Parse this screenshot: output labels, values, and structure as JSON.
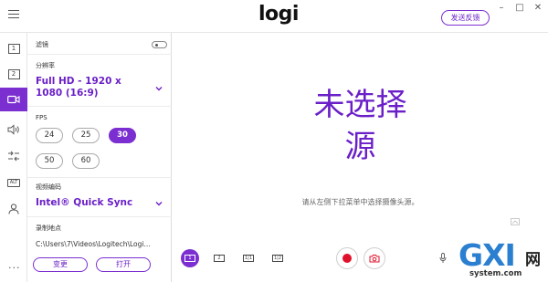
{
  "app": {
    "logo": "logi",
    "feedback_label": "发送反馈"
  },
  "window_controls": [
    "–",
    "□",
    "✕"
  ],
  "rail": {
    "items": [
      {
        "name": "layout-1",
        "label": "1"
      },
      {
        "name": "layout-2",
        "label": "2"
      },
      {
        "name": "camera",
        "label": ""
      },
      {
        "name": "audio",
        "label": ""
      },
      {
        "name": "transitions",
        "label": ""
      },
      {
        "name": "alt",
        "label": "ALT"
      },
      {
        "name": "account",
        "label": ""
      }
    ]
  },
  "panel": {
    "filter_label": "滤镜",
    "resolution_label": "分辨率",
    "resolution_value": "Full HD - 1920 x 1080 (16:9)",
    "fps_label": "FPS",
    "fps_options": [
      "24",
      "25",
      "30",
      "50",
      "60"
    ],
    "fps_selected": "30",
    "encoder_label": "视频编码",
    "encoder_value": "Intel® Quick Sync",
    "save_location_label": "录制地点",
    "save_path": "C:\\Users\\7\\Videos\\Logitech\\Logi...",
    "change_button": "变更",
    "open_button": "打开",
    "more": "···"
  },
  "preview": {
    "no_camera_line1": "未选择",
    "no_camera_line2": "源",
    "hint": "请从左侧下拉菜单中选择摄像头源。"
  },
  "toolbar": {
    "layout_labels": [
      "1",
      "2",
      "1|1",
      "1|2"
    ]
  },
  "watermark": {
    "brand": "GXI",
    "net": "网",
    "site": "system.com"
  },
  "colors": {
    "accent": "#7b2fd0",
    "record": "#e0112b"
  }
}
